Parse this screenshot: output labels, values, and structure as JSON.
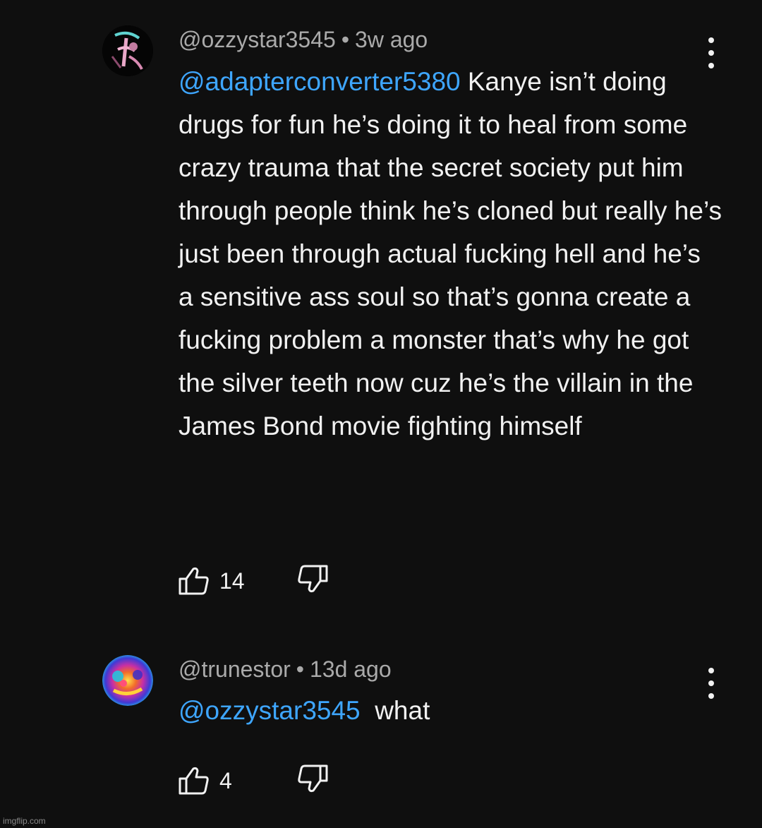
{
  "comments": [
    {
      "author": "@ozzystar3545",
      "separator": "•",
      "time": "3w ago",
      "mention": "@adapterconverter5380",
      "text": " Kanye isn’t doing drugs for fun he’s doing it to heal from some crazy trauma that the secret society put him through people think he’s cloned but really he’s just been through actual fucking hell and he’s a sensitive ass soul so that’s gonna create a fucking problem a monster that’s why he got the silver teeth now cuz he’s the villain in the James Bond movie fighting himself",
      "likes": "14",
      "icons": {
        "like": "thumb-up-icon",
        "dislike": "thumb-down-icon",
        "menu": "more-vert-icon"
      }
    },
    {
      "author": "@trunestor",
      "separator": "•",
      "time": "13d ago",
      "mention": "@ozzystar3545",
      "text": "  what",
      "likes": "4",
      "icons": {
        "like": "thumb-up-icon",
        "dislike": "thumb-down-icon",
        "menu": "more-vert-icon"
      }
    }
  ],
  "watermark": "imgflip.com",
  "colors": {
    "background": "#0f0f0f",
    "mention": "#3ea6ff",
    "meta": "#aaaaaa",
    "text": "#f1f1f1"
  }
}
